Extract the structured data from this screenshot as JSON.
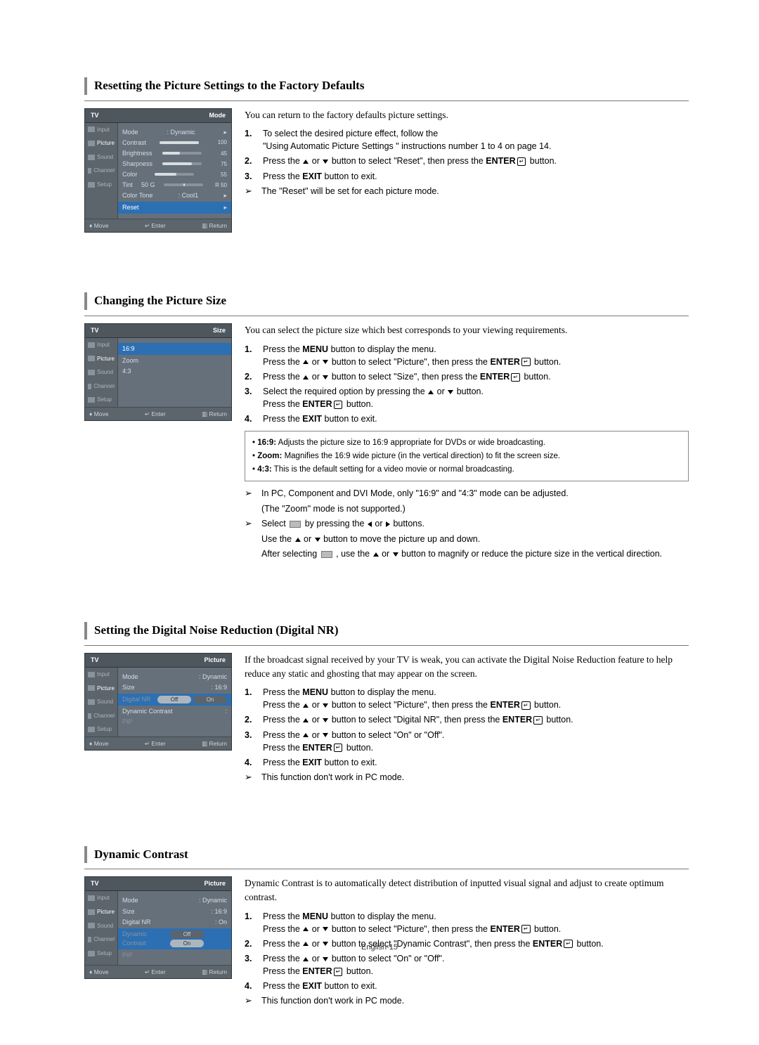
{
  "page_number": "English-15",
  "arrow_glyph": "➢",
  "sections": [
    {
      "title": "Resetting the Picture Settings to the Factory Defaults",
      "intro": "You can return to the factory defaults  picture settings.",
      "osd": {
        "tv": "TV",
        "header_right": "Mode",
        "side": [
          "Input",
          "Picture",
          "Sound",
          "Channel",
          "Setup"
        ],
        "rows": [
          {
            "label": "Mode",
            "value": ": Dynamic",
            "chev": true
          },
          {
            "label": "Contrast",
            "bar": 100,
            "num": "100"
          },
          {
            "label": "Brightness",
            "bar": 45,
            "num": "45"
          },
          {
            "label": "Sharpness",
            "bar": 75,
            "num": "75"
          },
          {
            "label": "Color",
            "bar": 55,
            "num": "55"
          },
          {
            "label": "Tint",
            "tint": "50 G",
            "tint2": "R 50"
          },
          {
            "label": "Color Tone",
            "value": ": Cool1",
            "chev": true
          },
          {
            "label": "Reset",
            "hl": true,
            "chev": true
          }
        ],
        "foot": {
          "move": "Move",
          "enter": "Enter",
          "ret": "Return"
        }
      },
      "steps": [
        {
          "n": "1.",
          "lines": [
            "To select the desired picture effect, follow the",
            "\"Using Automatic Picture Settings \" instructions number 1 to 4 on page 14."
          ]
        },
        {
          "n": "2.",
          "rich": [
            "Press the ",
            {
              "up": 1
            },
            " or ",
            {
              "dn": 1
            },
            " button to select \"Reset\", then press the ",
            {
              "b": "ENTER"
            },
            {
              "ent": 1
            },
            " button."
          ]
        },
        {
          "n": "3.",
          "rich": [
            "Press the ",
            {
              "b": "EXIT"
            },
            " button to exit."
          ]
        }
      ],
      "notes": [
        [
          "The \"Reset\" will be set for each picture mode."
        ]
      ]
    },
    {
      "title": "Changing the Picture Size",
      "intro": "You can select the picture size which best corresponds to your viewing requirements.",
      "osd": {
        "tv": "TV",
        "header_right": "Size",
        "side": [
          "Input",
          "Picture",
          "Sound",
          "Channel",
          "Setup"
        ],
        "rows": [
          {
            "label": "16:9",
            "hl": true
          },
          {
            "label": "Zoom"
          },
          {
            "label": "4:3"
          }
        ],
        "foot": {
          "move": "Move",
          "enter": "Enter",
          "ret": "Return"
        }
      },
      "steps": [
        {
          "n": "1.",
          "rich": [
            "Press the ",
            {
              "b": "MENU"
            },
            " button to display the menu."
          ],
          "rich2": [
            "Press the ",
            {
              "up": 1
            },
            " or ",
            {
              "dn": 1
            },
            " button to select \"Picture\",  then press the ",
            {
              "b": "ENTER"
            },
            {
              "ent": 1
            },
            " button."
          ]
        },
        {
          "n": "2.",
          "rich": [
            "Press the ",
            {
              "up": 1
            },
            " or ",
            {
              "dn": 1
            },
            " button to select \"Size\", then press the ",
            {
              "b": "ENTER"
            },
            {
              "ent": 1
            },
            " button."
          ]
        },
        {
          "n": "3.",
          "rich": [
            "Select the required option by pressing the ",
            {
              "up": 1
            },
            " or ",
            {
              "dn": 1
            },
            " button."
          ],
          "rich2": [
            "Press the ",
            {
              "b": "ENTER"
            },
            {
              "ent": 1
            },
            " button."
          ]
        },
        {
          "n": "4.",
          "rich": [
            "Press the ",
            {
              "b": "EXIT"
            },
            " button to exit."
          ]
        }
      ],
      "box": [
        {
          "b": "16:9:",
          "t": " Adjusts the picture size to 16:9 appropriate for DVDs or wide broadcasting."
        },
        {
          "b": "Zoom:",
          "t": " Magnifies the 16:9 wide picture (in the vertical direction) to fit the screen size."
        },
        {
          "b": "4:3:",
          "t": " This is the default setting for a video movie or normal broadcasting."
        }
      ],
      "notes": [
        [
          "In PC, Component and DVI Mode, only \"16:9\" and \"4:3\" mode can be adjusted."
        ],
        [
          "(The \"Zoom\" mode is not supported.)"
        ],
        [
          {
            "t": "Select "
          },
          {
            "sel": 1
          },
          {
            "t": "  by pressing the "
          },
          {
            "lf": 1
          },
          {
            "t": " or "
          },
          {
            "rt": 1
          },
          {
            "t": " buttons."
          }
        ],
        [
          {
            "t": "Use the "
          },
          {
            "up": 1
          },
          {
            "t": " or "
          },
          {
            "dn": 1
          },
          {
            "t": " button to move the picture up and down."
          }
        ],
        [
          {
            "t": "After selecting "
          },
          {
            "sel": 1
          },
          {
            "t": " , use the "
          },
          {
            "up": 1
          },
          {
            "t": " or "
          },
          {
            "dn": 1
          },
          {
            "t": " button to magnify or reduce the picture size in the vertical direction."
          }
        ]
      ],
      "notes_arrow_at": [
        0,
        2
      ]
    },
    {
      "title": "Setting the Digital Noise Reduction (Digital NR)",
      "intro": "If the broadcast signal received by your TV is weak, you can activate the Digital Noise Reduction feature to help reduce any static and ghosting that may appear on the screen.",
      "osd": {
        "tv": "TV",
        "header_right": "Picture",
        "side": [
          "Input",
          "Picture",
          "Sound",
          "Channel",
          "Setup"
        ],
        "rows": [
          {
            "label": "Mode",
            "value": ": Dynamic"
          },
          {
            "label": "Size",
            "value": ": 16:9"
          },
          {
            "label": "Digital NR",
            "dim": true,
            "pills": [
              "Off",
              "On"
            ],
            "hl": true,
            "sel": 0
          },
          {
            "label": "Dynamic Contrast",
            "value": ":"
          },
          {
            "label": "PIP",
            "dim": true
          }
        ],
        "foot": {
          "move": "Move",
          "enter": "Enter",
          "ret": "Return"
        }
      },
      "steps": [
        {
          "n": "1.",
          "rich": [
            "Press the ",
            {
              "b": "MENU"
            },
            " button to display the menu."
          ],
          "rich2": [
            "Press the ",
            {
              "up": 1
            },
            " or ",
            {
              "dn": 1
            },
            " button to select \"Picture\", then press the ",
            {
              "b": "ENTER"
            },
            {
              "ent": 1
            },
            " button."
          ]
        },
        {
          "n": "2.",
          "rich": [
            "Press the ",
            {
              "up": 1
            },
            " or ",
            {
              "dn": 1
            },
            " button to select \"Digital NR\", then press the ",
            {
              "b": "ENTER"
            },
            {
              "ent": 1
            },
            " button."
          ]
        },
        {
          "n": "3.",
          "rich": [
            "Press the ",
            {
              "up": 1
            },
            " or ",
            {
              "dn": 1
            },
            " button to select \"On\" or \"Off\"."
          ],
          "rich2": [
            "Press the ",
            {
              "b": "ENTER"
            },
            {
              "ent": 1
            },
            " button."
          ]
        },
        {
          "n": "4.",
          "rich": [
            "Press the ",
            {
              "b": "EXIT"
            },
            " button to exit."
          ]
        }
      ],
      "notes": [
        [
          "This function don't work in PC mode."
        ]
      ]
    },
    {
      "title": "Dynamic Contrast",
      "intro": "Dynamic Contrast is to automatically detect distribution of inputted visual signal and adjust to create optimum contrast.",
      "osd": {
        "tv": "TV",
        "header_right": "Picture",
        "side": [
          "Input",
          "Picture",
          "Sound",
          "Channel",
          "Setup"
        ],
        "rows": [
          {
            "label": "Mode",
            "value": ": Dynamic"
          },
          {
            "label": "Size",
            "value": ": 16:9"
          },
          {
            "label": "Digital NR",
            "value": ": On"
          },
          {
            "label": "Dynamic Contrast",
            "dim": true,
            "hl": true,
            "pills": [
              "Off",
              "On"
            ],
            "sel": 1
          },
          {
            "label": "PIP",
            "dim": true
          }
        ],
        "foot": {
          "move": "Move",
          "enter": "Enter",
          "ret": "Return"
        }
      },
      "steps": [
        {
          "n": "1.",
          "rich": [
            "Press the ",
            {
              "b": "MENU"
            },
            " button to display the menu."
          ],
          "rich2": [
            "Press the ",
            {
              "up": 1
            },
            " or ",
            {
              "dn": 1
            },
            " button to select \"Picture\",  then press the ",
            {
              "b": "ENTER"
            },
            {
              "ent": 1
            },
            " button."
          ]
        },
        {
          "n": "2.",
          "rich": [
            "Press the ",
            {
              "up": 1
            },
            " or ",
            {
              "dn": 1
            },
            " button to select \"Dynamic Contrast\", then press the ",
            {
              "b": "ENTER"
            },
            {
              "ent": 1
            },
            " button."
          ]
        },
        {
          "n": "3.",
          "rich": [
            "Press the ",
            {
              "up": 1
            },
            " or ",
            {
              "dn": 1
            },
            " button to select \"On\" or \"Off\"."
          ],
          "rich2": [
            "Press the ",
            {
              "b": "ENTER"
            },
            {
              "ent": 1
            },
            " button."
          ]
        },
        {
          "n": "4.",
          "rich": [
            "Press the ",
            {
              "b": "EXIT"
            },
            " button to exit."
          ]
        }
      ],
      "notes": [
        [
          "This function don't work in PC mode."
        ]
      ]
    }
  ]
}
